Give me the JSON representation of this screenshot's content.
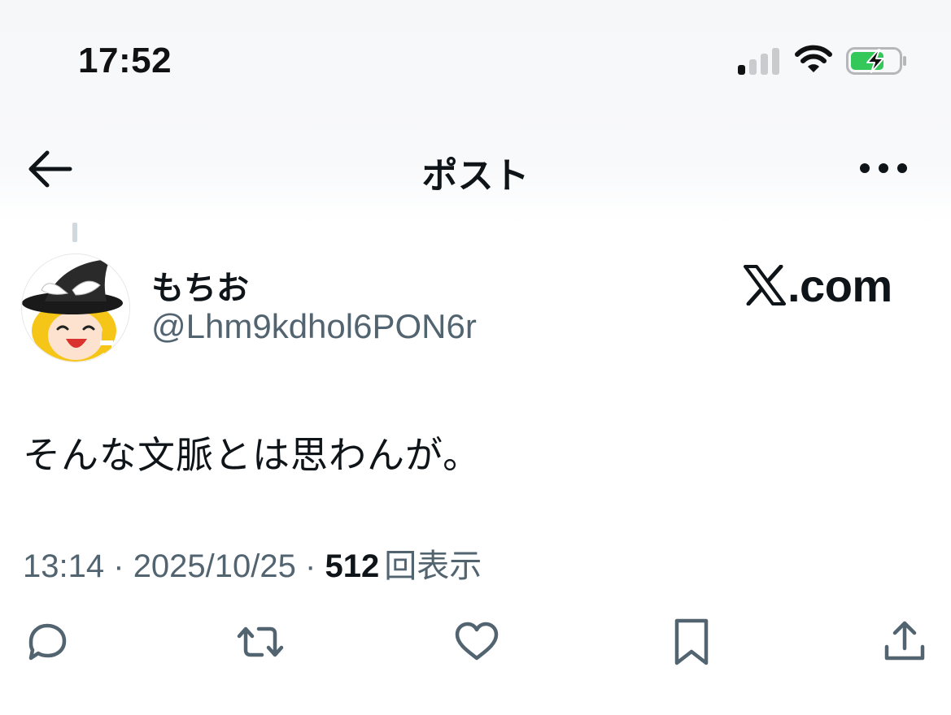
{
  "status_bar": {
    "time": "17:52",
    "icons": [
      "cellular-signal-icon",
      "wifi-icon",
      "battery-charging-icon"
    ],
    "battery_color": "#34c759"
  },
  "nav": {
    "title": "ポスト",
    "back_icon": "arrow-left-icon",
    "more_icon": "more-horizontal-icon"
  },
  "post": {
    "author": {
      "display_name": "もちお",
      "handle": "@Lhm9kdhol6PON6r"
    },
    "brand": "X.com",
    "brand_suffix": ".com",
    "text": "そんな文脈とは思わんが。",
    "time": "13:14",
    "separator": "·",
    "date": "2025/10/25",
    "views_count": "512",
    "views_label": "回表示"
  },
  "actions": [
    {
      "name": "reply",
      "icon": "reply-icon"
    },
    {
      "name": "repost",
      "icon": "repost-icon"
    },
    {
      "name": "like",
      "icon": "heart-icon"
    },
    {
      "name": "bookmark",
      "icon": "bookmark-icon"
    },
    {
      "name": "share",
      "icon": "share-icon"
    }
  ],
  "colors": {
    "text_primary": "#0f1419",
    "text_secondary": "#536471"
  }
}
